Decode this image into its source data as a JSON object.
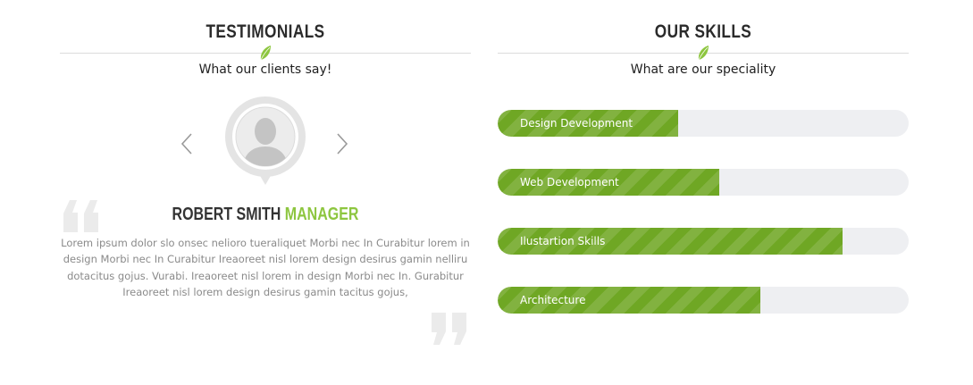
{
  "testimonials": {
    "title": "TESTIMONIALS",
    "subtitle": "What our clients say!",
    "name": "ROBERT SMITH",
    "role": "MANAGER",
    "text": "Lorem ipsum dolor slo onsec nelioro tueraliquet Morbi nec In Curabitur lorem in design Morbi nec In Curabitur Ireaoreet nisl lorem design desirus gamin nelliru dotacitus gojus. Vurabi. Ireaoreet nisl lorem in design Morbi nec In. Gurabitur Ireaoreet nisl lorem design desirus gamin tacitus gojus,",
    "icons": {
      "prev": "chevron-left-icon",
      "next": "chevron-right-icon",
      "avatar": "user-placeholder-icon",
      "quote_open": "quote-open-icon",
      "quote_close": "quote-close-icon",
      "leaf": "leaf-icon"
    }
  },
  "skills": {
    "title": "OUR SKILLS",
    "subtitle": "What are our speciality",
    "items": [
      {
        "label": "Design Development",
        "percent": 44
      },
      {
        "label": "Web Development",
        "percent": 54
      },
      {
        "label": "Ilustartion Skills",
        "percent": 84
      },
      {
        "label": "Architecture",
        "percent": 64
      }
    ]
  },
  "colors": {
    "accent": "#8dc63f",
    "bar_fill": "#6fa724",
    "bar_track": "#eeeff2",
    "text_muted": "#8a8a8a"
  }
}
